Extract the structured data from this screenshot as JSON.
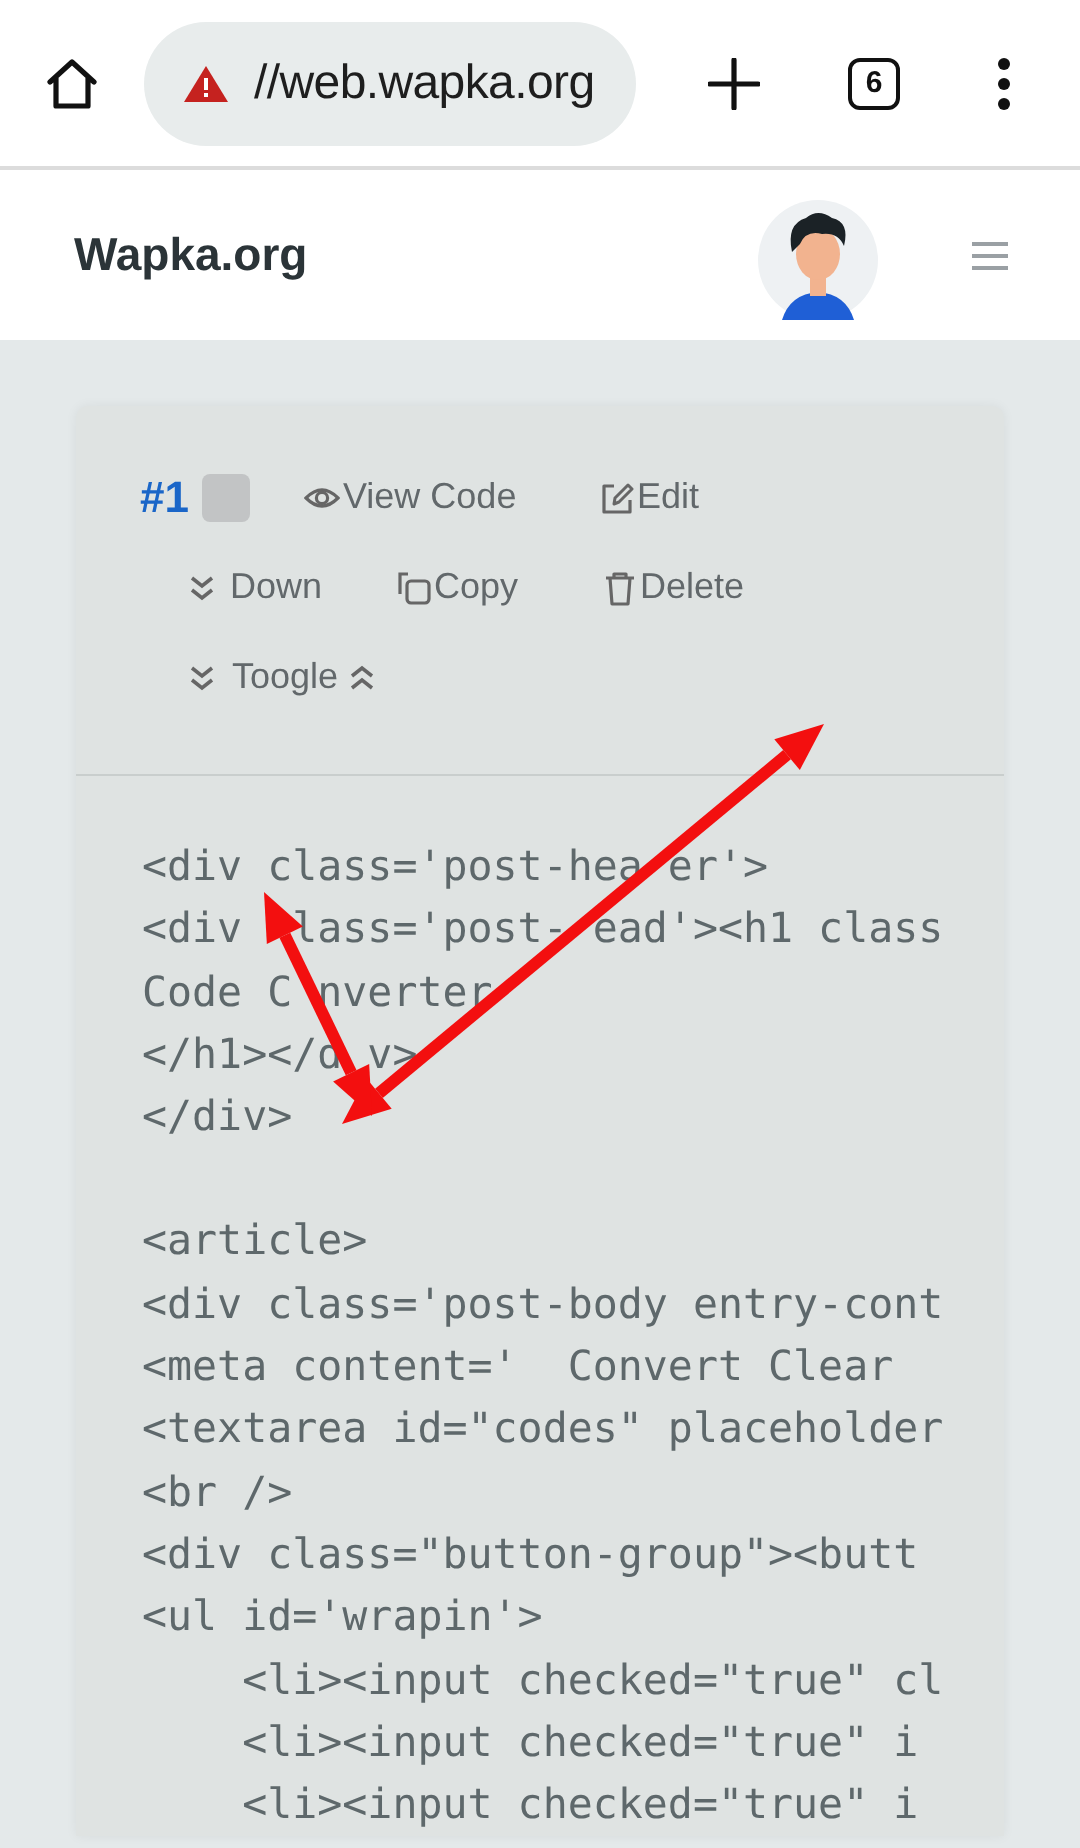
{
  "browser": {
    "url": "//web.wapka.org",
    "tab_count": "6"
  },
  "site": {
    "title": "Wapka.org"
  },
  "post": {
    "actions": [
      [
        {
          "kind": "number",
          "label": "#1"
        },
        {
          "kind": "checkbox",
          "checked": false
        },
        {
          "kind": "action",
          "label": "View Code"
        },
        {
          "kind": "action",
          "label": "Edit"
        }
      ],
      [
        {
          "kind": "action",
          "label": "Down"
        },
        {
          "kind": "action",
          "label": "Copy"
        },
        {
          "kind": "action",
          "label": "Delete"
        }
      ],
      [
        {
          "kind": "toggle",
          "label": "Toogle"
        }
      ]
    ],
    "code_blocks": [
      [
        "<div class='post-hea er'>",
        "<div  lass='post- ead'><h1 class",
        "Code C nverter",
        "</h1></d v>",
        "</div>"
      ],
      [
        "<article>",
        "<div class='post-body entry-cont",
        "<meta content='  Convert Clear",
        "<textarea id=\"codes\" placeholder",
        "<br />",
        "<div class=\"button-group\"><butt",
        "<ul id='wrapin'>",
        "    <li><input checked=\"true\" cl",
        "    <li><input checked=\"true\" i",
        "    <li><input checked=\"true\" i"
      ]
    ]
  }
}
